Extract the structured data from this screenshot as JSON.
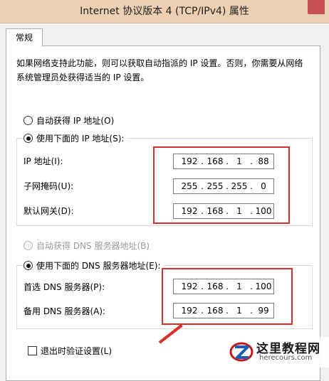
{
  "window": {
    "title": "Internet 协议版本 4 (TCP/IPv4) 属性"
  },
  "tabs": [
    {
      "label": "常规",
      "active": true
    }
  ],
  "description": "如果网络支持此功能，则可以获取自动指派的 IP 设置。否则，你需要从网络系统管理员处获得适当的 IP 设置。",
  "ip_section": {
    "auto_option": "自动获得 IP 地址(O)",
    "manual_option": "使用下面的 IP 地址(S):",
    "selected": "manual",
    "fields": [
      {
        "label": "IP 地址(I):",
        "octets": [
          "192",
          "168",
          "1",
          "88"
        ]
      },
      {
        "label": "子网掩码(U):",
        "octets": [
          "255",
          "255",
          "255",
          "0"
        ]
      },
      {
        "label": "默认网关(D):",
        "octets": [
          "192",
          "168",
          "1",
          "100"
        ]
      }
    ]
  },
  "dns_section": {
    "auto_option": "自动获得 DNS 服务器地址(B)",
    "manual_option": "使用下面的 DNS 服务器地址(E):",
    "selected": "manual",
    "fields": [
      {
        "label": "首选 DNS 服务器(P):",
        "octets": [
          "192",
          "168",
          "1",
          "100"
        ]
      },
      {
        "label": "备用 DNS 服务器(A):",
        "octets": [
          "192",
          "168",
          "1",
          "99"
        ]
      }
    ]
  },
  "validate_checkbox": {
    "label": "退出时验证设置(L)",
    "checked": false
  },
  "watermark": {
    "name": "这里教程网",
    "url": "herecours.com"
  },
  "colors": {
    "titlebar": "#edcfb2",
    "highlight": "#d9302c",
    "close": "#c75050"
  }
}
